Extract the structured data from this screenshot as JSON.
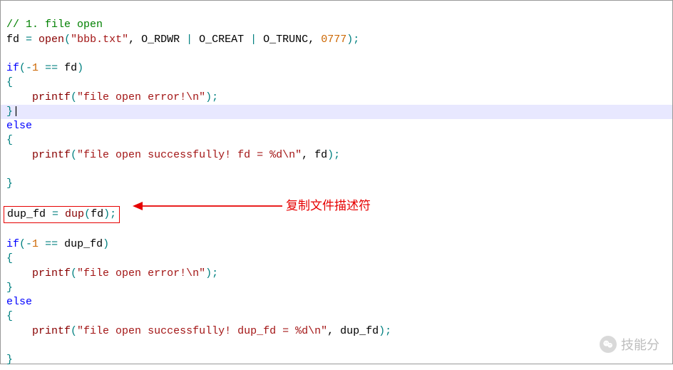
{
  "code": {
    "l1": {
      "comment": "// 1. file open"
    },
    "l2": {
      "a": "fd ",
      "eq": "=",
      "sp": " ",
      "fn": "open",
      "lp": "(",
      "str": "\"bbb.txt\"",
      "c1": ", ",
      "m1": "O_RDWR",
      "pipe1": " | ",
      "m2": "O_CREAT",
      "pipe2": " | ",
      "m3": "O_TRUNC",
      "c2": ", ",
      "num": "0777",
      "rp": ")",
      "semi": ";"
    },
    "l3": "",
    "l4": {
      "kw": "if",
      "lp": "(",
      "neg": "-",
      "one": "1",
      "sp1": " ",
      "eq": "==",
      "sp2": " ",
      "id": "fd",
      "rp": ")"
    },
    "l5": {
      "brace": "{"
    },
    "l6": {
      "indent": "    ",
      "fn": "printf",
      "lp": "(",
      "str": "\"file open error!\\n\"",
      "rp": ")",
      "semi": ";"
    },
    "l7": {
      "brace": "}"
    },
    "l8": {
      "kw": "else"
    },
    "l9": {
      "brace": "{"
    },
    "l10": {
      "indent": "    ",
      "fn": "printf",
      "lp": "(",
      "str": "\"file open successfully! fd = %d\\n\"",
      "c": ", ",
      "id": "fd",
      "rp": ")",
      "semi": ";"
    },
    "l11": "",
    "l12": {
      "brace": "}"
    },
    "l13": "",
    "l14": {
      "id1": "dup_fd ",
      "eq": "=",
      "sp": " ",
      "fn": "dup",
      "lp": "(",
      "id2": "fd",
      "rp": ")",
      "semi": ";"
    },
    "l15": "",
    "l16": {
      "kw": "if",
      "lp": "(",
      "neg": "-",
      "one": "1",
      "sp1": " ",
      "eq": "==",
      "sp2": " ",
      "id": "dup_fd",
      "rp": ")"
    },
    "l17": {
      "brace": "{"
    },
    "l18": {
      "indent": "    ",
      "fn": "printf",
      "lp": "(",
      "str": "\"file open error!\\n\"",
      "rp": ")",
      "semi": ";"
    },
    "l19": {
      "brace": "}"
    },
    "l20": {
      "kw": "else"
    },
    "l21": {
      "brace": "{"
    },
    "l22": {
      "indent": "    ",
      "fn": "printf",
      "lp": "(",
      "str": "\"file open successfully! dup_fd = %d\\n\"",
      "c": ", ",
      "id": "dup_fd",
      "rp": ")",
      "semi": ";"
    },
    "l23": "",
    "l24": {
      "brace": "}"
    }
  },
  "annotation": {
    "label": "复制文件描述符"
  },
  "watermark": {
    "text": "技能分"
  }
}
